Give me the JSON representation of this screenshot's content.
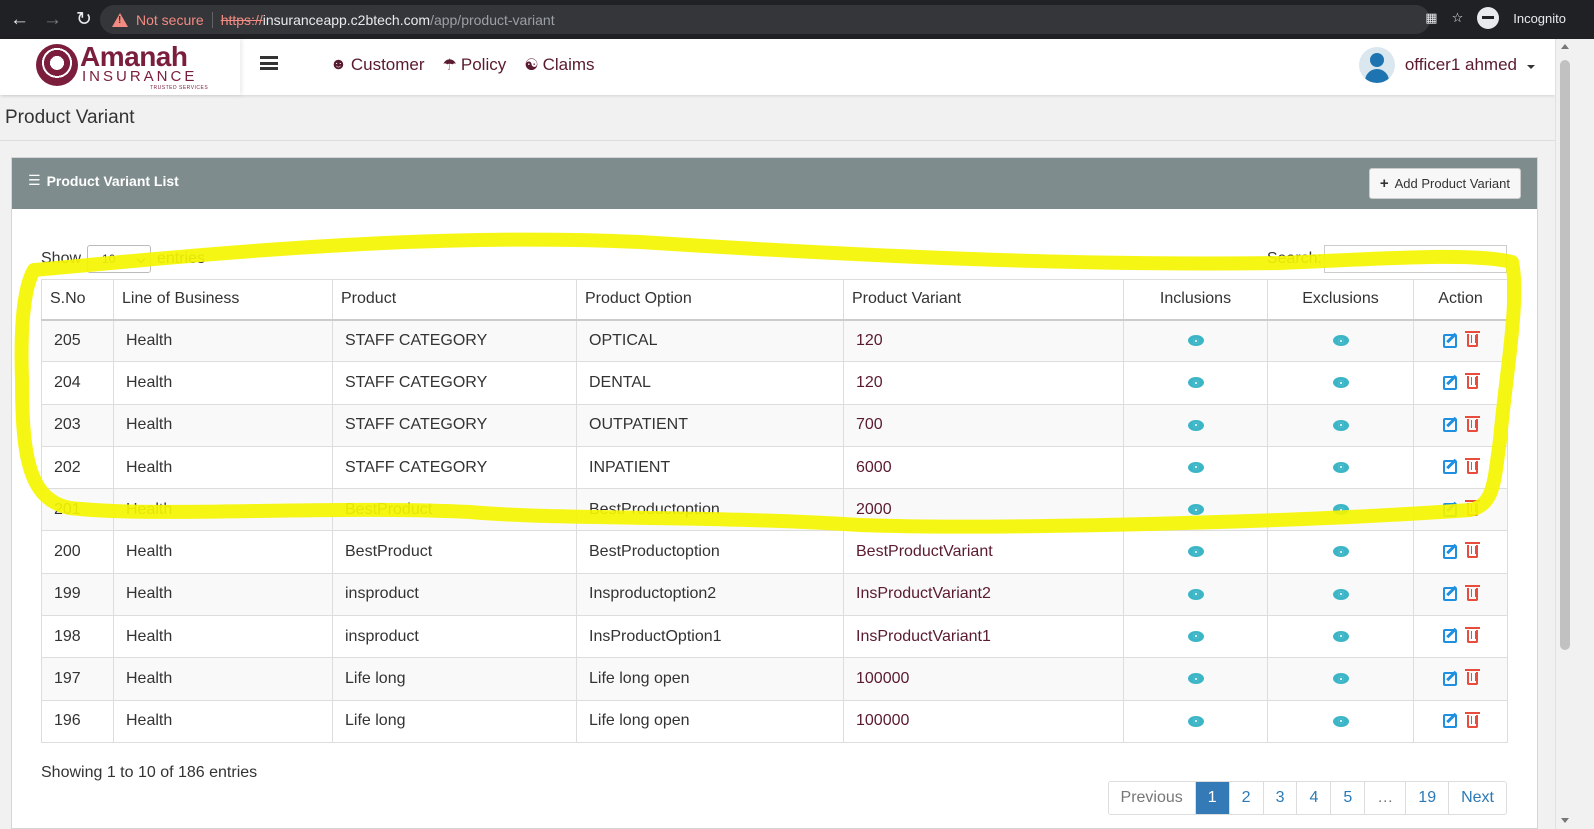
{
  "browser": {
    "security_label": "Not secure",
    "url_scheme": "https://",
    "url_host": "insuranceapp.c2btech.com",
    "url_path": "/app/product-variant",
    "profile_label": "Incognito"
  },
  "header": {
    "logo_name": "Amanah",
    "logo_subtitle": "INSURANCE",
    "logo_tagline": "TRUSTED SERVICES",
    "nav": [
      {
        "label": "Customer",
        "icon": "user-icon"
      },
      {
        "label": "Policy",
        "icon": "umbrella-icon"
      },
      {
        "label": "Claims",
        "icon": "claims-icon"
      }
    ],
    "user_name": "officer1 ahmed"
  },
  "page": {
    "title": "Product Variant"
  },
  "panel": {
    "title": "Product Variant List",
    "add_button": "Add Product Variant",
    "show_label": "Show",
    "entries_label": "entries",
    "page_size": "10",
    "search_label": "Search:",
    "search_value": "",
    "columns": [
      "S.No",
      "Line of Business",
      "Product",
      "Product Option",
      "Product Variant",
      "Inclusions",
      "Exclusions",
      "Action"
    ],
    "rows": [
      {
        "sno": "205",
        "lob": "Health",
        "product": "STAFF CATEGORY",
        "option": "OPTICAL",
        "variant": "120"
      },
      {
        "sno": "204",
        "lob": "Health",
        "product": "STAFF CATEGORY",
        "option": "DENTAL",
        "variant": "120"
      },
      {
        "sno": "203",
        "lob": "Health",
        "product": "STAFF CATEGORY",
        "option": "OUTPATIENT",
        "variant": "700"
      },
      {
        "sno": "202",
        "lob": "Health",
        "product": "STAFF CATEGORY",
        "option": "INPATIENT",
        "variant": "6000"
      },
      {
        "sno": "201",
        "lob": "Health",
        "product": "BestProduct",
        "option": "BestProductoption",
        "variant": "2000"
      },
      {
        "sno": "200",
        "lob": "Health",
        "product": "BestProduct",
        "option": "BestProductoption",
        "variant": "BestProductVariant"
      },
      {
        "sno": "199",
        "lob": "Health",
        "product": "insproduct",
        "option": "Insproductoption2",
        "variant": "InsProductVariant2"
      },
      {
        "sno": "198",
        "lob": "Health",
        "product": "insproduct",
        "option": "InsProductOption1",
        "variant": "InsProductVariant1"
      },
      {
        "sno": "197",
        "lob": "Health",
        "product": "Life long",
        "option": "Life long open",
        "variant": "100000"
      },
      {
        "sno": "196",
        "lob": "Health",
        "product": "Life long",
        "option": "Life long open",
        "variant": "100000"
      }
    ],
    "info": "Showing 1 to 10 of 186 entries",
    "pagination": [
      "Previous",
      "1",
      "2",
      "3",
      "4",
      "5",
      "…",
      "19",
      "Next"
    ],
    "active_page": "1"
  },
  "colors": {
    "brand": "#7a1e3b",
    "panel_header": "#7f8c8d",
    "highlight": "#f5f500",
    "view_icon": "#3cb6c7",
    "edit_icon": "#1f8fe0",
    "delete_icon": "#e74c3c",
    "active_page": "#337ab7"
  }
}
